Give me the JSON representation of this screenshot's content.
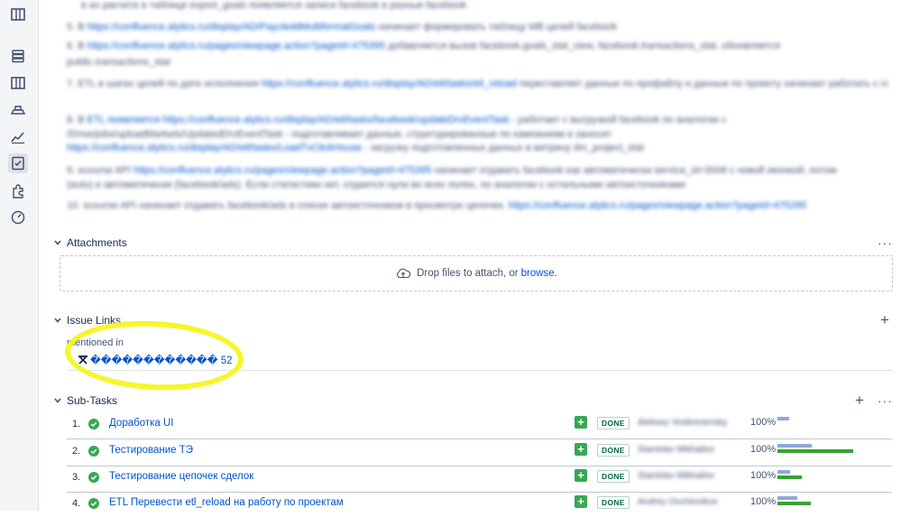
{
  "description_lines": [
    {
      "text": "в ах расчете в таблице export_goals появляется записи facebook в разные facebook",
      "link": ""
    },
    {
      "text": "5. В ",
      "link": "https://confluence.alytics.ru/display/AD/PaycleddMultiformatGoals",
      "tail": " начинает формировать таблицу MB целей facebook"
    },
    {
      "text": "6. В ",
      "link": "https://confluence.alytics.ru/pages/viewpage.action?pageId=475395",
      "tail": " добавляется вызов facebook.goals_stat_view, facebook.transactions_stat, обновляется"
    },
    {
      "text": "public.transactions_stat",
      "link": ""
    },
    {
      "text": "7. ETL в шагах целей по дате исполнения ",
      "link": "https://confluence.alytics.ru/display/AD/etl/tasks/etl_reload",
      "tail": " переставляет данные по профайлу и данные по проекту начинает работать с готовыми связками по проекту manual"
    },
    {
      "text": "8. В ",
      "link": "ETL появляется https://confluence.alytics.ru/display/AD/etl/tasks/facebook/updateDrvEventTask",
      "tail": " - работает с выгрузкой facebook по аналогии с"
    },
    {
      "text": "/Drive/jobs/uploadMarkets/UpdatedDrvEventTask - подготавливает данные, структурированные по кампаниям и заносит",
      "link": ""
    },
    {
      "text": "",
      "link": "https://confluence.alytics.ru/display/AD/etl/tasks/LoadTvClickHouse",
      "tail": " - загрузку подготовленных данных в витрину dm_project_stat"
    },
    {
      "text": "9. scourse API ",
      "link": "https://confluence.alytics.ru/pages/viewpage.action?pageId=475395",
      "tail": " начинает отдавать facebook как автоматически service_id=3008 с новой иконкой, потом"
    },
    {
      "text": "(auto) и автоматически (facebook/ads). Если статистики нет, отдается нули во всех полях, по аналогии с остальными автоисточниками",
      "link": ""
    },
    {
      "text": "10. scourse API начинает отдавать facebook/ads в списке автоисточников в просмотре целочек. ",
      "link": "https://confluence.alytics.ru/pages/viewpage.action?pageId=475295",
      "tail": ""
    }
  ],
  "attachments": {
    "title": "Attachments",
    "drop_text": "Drop files to attach, or",
    "browse_label": "browse."
  },
  "issue_links": {
    "title": "Issue Links",
    "relation": "mentioned in",
    "link_text": "������������ 52"
  },
  "subtasks": {
    "title": "Sub-Tasks",
    "items": [
      {
        "num": "1.",
        "title": "Доработка UI",
        "status": "DONE",
        "assignee": "Aleksey Voskresensky",
        "pct": "100%",
        "blue": 0.15,
        "green": 0.0
      },
      {
        "num": "2.",
        "title": "Тестирование ТЭ",
        "status": "DONE",
        "assignee": "Stanislav Mikhailov",
        "pct": "100%",
        "blue": 0.45,
        "green": 1.0
      },
      {
        "num": "3.",
        "title": "Тестирование цепочек сделок",
        "status": "DONE",
        "assignee": "Stanislav Mikhailov",
        "pct": "100%",
        "blue": 0.17,
        "green": 0.32
      },
      {
        "num": "4.",
        "title": "ETL Перевести etl_reload на работу по проектам",
        "status": "DONE",
        "assignee": "Andrey Ovchinnikov",
        "pct": "100%",
        "blue": 0.26,
        "green": 0.44
      }
    ]
  },
  "more_label": "···",
  "add_label": "+",
  "colors": {
    "accent": "#0052cc",
    "done": "#36a854",
    "highlight": "#f5f51e"
  }
}
